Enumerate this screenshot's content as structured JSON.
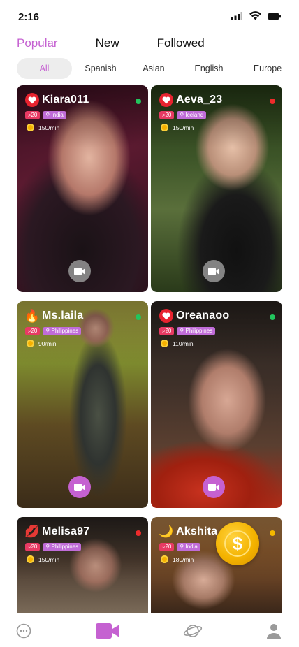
{
  "status": {
    "time": "2:16"
  },
  "tabs": [
    {
      "label": "Popular",
      "active": true
    },
    {
      "label": "New",
      "active": false
    },
    {
      "label": "Followed",
      "active": false
    }
  ],
  "filters": [
    {
      "label": "All",
      "active": true
    },
    {
      "label": "Spanish",
      "active": false
    },
    {
      "label": "Asian",
      "active": false
    },
    {
      "label": "English",
      "active": false
    },
    {
      "label": "Europe",
      "active": false
    }
  ],
  "cards": [
    {
      "name": "Kiara011",
      "badge": "heart",
      "count": "20",
      "country": "India",
      "rate": "150/min",
      "status_color": "#22c55e",
      "video_style": "grey"
    },
    {
      "name": "Aeva_23",
      "badge": "heart",
      "count": "20",
      "country": "Iceland",
      "rate": "150/min",
      "status_color": "#ef2b2b",
      "video_style": "grey"
    },
    {
      "name": "Ms.laila",
      "badge": "flame",
      "count": "20",
      "country": "Philippines",
      "rate": "90/min",
      "status_color": "#22c55e",
      "video_style": "purple"
    },
    {
      "name": "Oreanaoo",
      "badge": "heart",
      "count": "20",
      "country": "Philippines",
      "rate": "110/min",
      "status_color": "#22c55e",
      "video_style": "purple"
    },
    {
      "name": "Melisa97",
      "badge": "lips",
      "count": "20",
      "country": "Philippines",
      "rate": "150/min",
      "status_color": "#ef2b2b",
      "video_style": "none"
    },
    {
      "name": "Akshita",
      "badge": "moon",
      "count": "20",
      "country": "India",
      "rate": "180/min",
      "status_color": "#f3b800",
      "video_style": "none"
    }
  ],
  "colors": {
    "accent": "#c561d1",
    "coin": "#f4b300"
  },
  "nav": [
    "chat-icon",
    "video-camera-icon",
    "planet-icon",
    "profile-icon"
  ]
}
